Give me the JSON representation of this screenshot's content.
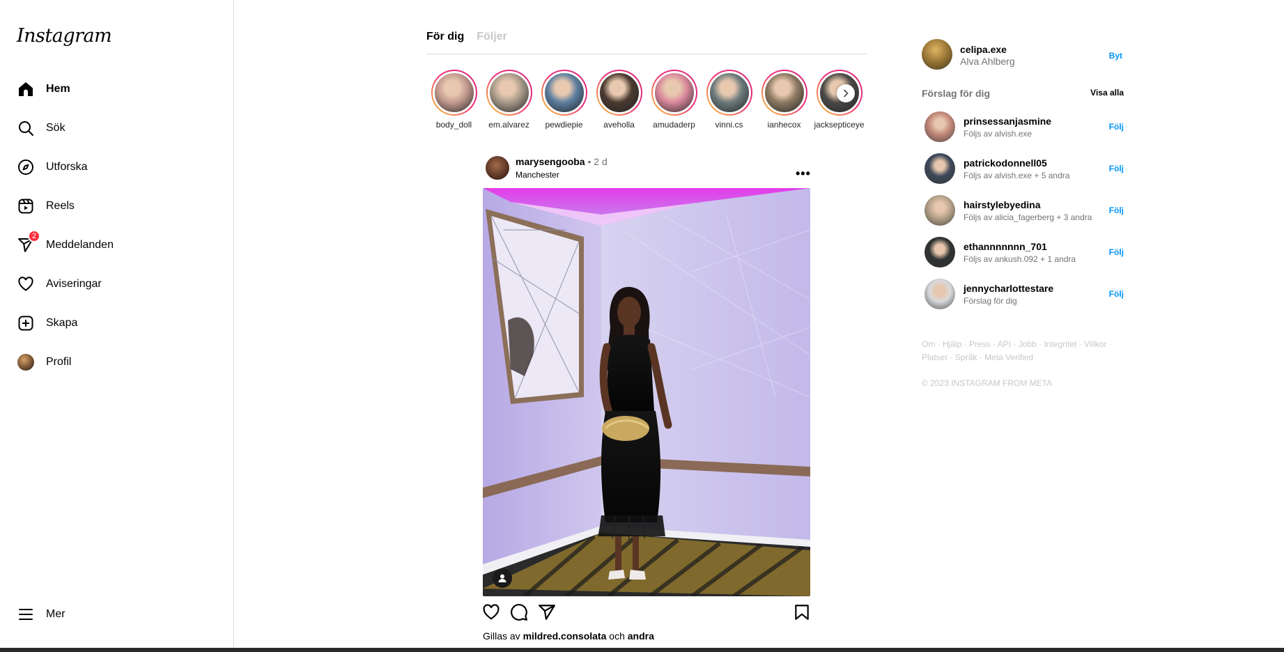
{
  "sidebar": {
    "logo": "Instagram",
    "items": [
      {
        "label": "Hem",
        "icon": "home-icon",
        "active": true
      },
      {
        "label": "Sök",
        "icon": "search-icon"
      },
      {
        "label": "Utforska",
        "icon": "compass-icon"
      },
      {
        "label": "Reels",
        "icon": "reels-icon"
      },
      {
        "label": "Meddelanden",
        "icon": "messenger-icon",
        "badge": "2"
      },
      {
        "label": "Aviseringar",
        "icon": "heart-icon"
      },
      {
        "label": "Skapa",
        "icon": "plus-square-icon"
      },
      {
        "label": "Profil",
        "icon": "avatar"
      }
    ],
    "more_label": "Mer"
  },
  "feed": {
    "tabs": [
      {
        "label": "För dig",
        "active": true
      },
      {
        "label": "Följer",
        "active": false
      }
    ],
    "stories": [
      {
        "name": "body_doll",
        "color": "#c49a8f"
      },
      {
        "name": "em.alvarez",
        "color": "#a89a8a"
      },
      {
        "name": "pewdiepie",
        "color": "#5d7fa0"
      },
      {
        "name": "aveholla",
        "color": "#4a3a30"
      },
      {
        "name": "amudaderp",
        "color": "#d9889b"
      },
      {
        "name": "vinni.cs",
        "color": "#6c7a7c"
      },
      {
        "name": "ianhecox",
        "color": "#8c7a62"
      },
      {
        "name": "jacksepticeye",
        "color": "#4b4a48"
      }
    ],
    "post": {
      "username": "marysengooba",
      "separator": "•",
      "time": "2 d",
      "location": "Manchester",
      "likes_prefix": "Gillas av",
      "likes_user": "mildred.consolata",
      "likes_mid": "och",
      "likes_others": "andra"
    }
  },
  "right": {
    "me": {
      "username": "celipa.exe",
      "name": "Alva Ahlberg",
      "switch_label": "Byt"
    },
    "suggestions_title": "Förslag för dig",
    "see_all": "Visa alla",
    "follow_label": "Följ",
    "suggestions": [
      {
        "username": "prinsessanjasmine",
        "sub": "Följs av alvish.exe",
        "color": "#c48a7a"
      },
      {
        "username": "patrickodonnell05",
        "sub": "Följs av alvish.exe + 5 andra",
        "color": "#3d4858"
      },
      {
        "username": "hairstylebyedina",
        "sub": "Följs av alicia_fagerberg + 3 andra",
        "color": "#b9a48c"
      },
      {
        "username": "ethannnnnnn_701",
        "sub": "Följs av ankush.092 + 1 andra",
        "color": "#2e3230"
      },
      {
        "username": "jennycharlottestare",
        "sub": "Förslag för dig",
        "color": "#d7d9dc"
      }
    ],
    "footer_links": [
      "Om",
      "Hjälp",
      "Press",
      "API",
      "Jobb",
      "Integritet",
      "Villkor",
      "Platser",
      "Språk",
      "Meta Verified"
    ],
    "copyright": "© 2023 INSTAGRAM FROM META"
  }
}
